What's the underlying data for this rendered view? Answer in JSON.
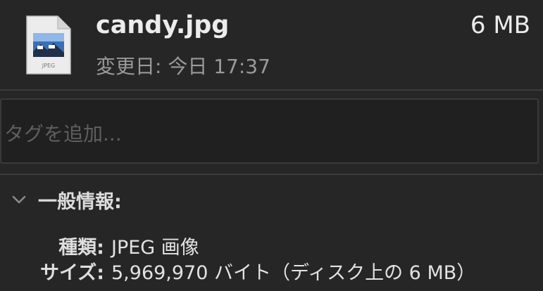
{
  "file": {
    "name": "candy.jpg",
    "size": "6 MB",
    "modified": "変更日: 今日 17:37",
    "icon": "jpeg-file-icon",
    "icon_badge": "JPEG"
  },
  "tags": {
    "placeholder": "タグを追加...",
    "value": ""
  },
  "general": {
    "title": "一般情報:",
    "expanded": true,
    "rows": [
      {
        "label": "種類:",
        "value": "JPEG 画像"
      },
      {
        "label": "サイズ:",
        "value": "5,969,970 バイト（ディスク上の 6 MB）"
      }
    ]
  },
  "colors": {
    "background": "#262626",
    "field_background": "#202020",
    "secondary_text": "#9a9a9a",
    "placeholder_text": "#5e5e5e"
  }
}
